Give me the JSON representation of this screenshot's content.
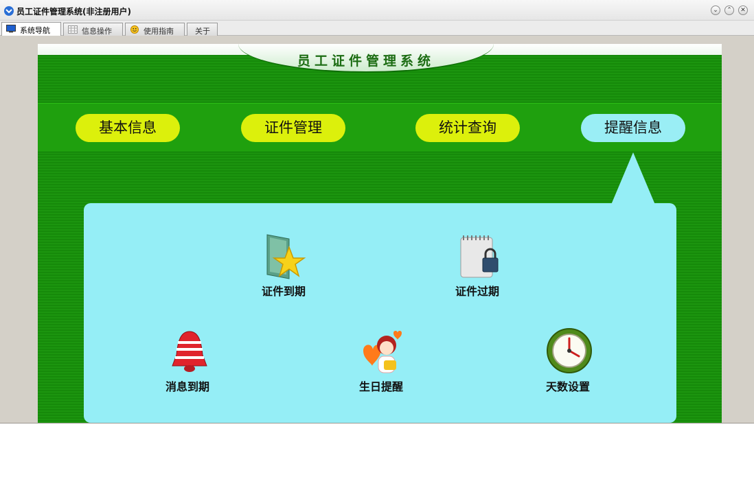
{
  "window": {
    "title": "员工证件管理系统(非注册用户)"
  },
  "tabs": [
    {
      "label": "系统导航",
      "icon": "monitor-icon",
      "active": true
    },
    {
      "label": "信息操作",
      "icon": "grid-icon",
      "active": false
    },
    {
      "label": "使用指南",
      "icon": "face-icon",
      "active": false
    },
    {
      "label": "关于",
      "icon": "",
      "active": false
    }
  ],
  "system": {
    "title": "员工证件管理系统"
  },
  "nav": [
    {
      "label": "基本信息"
    },
    {
      "label": "证件管理"
    },
    {
      "label": "统计查询"
    },
    {
      "label": "提醒信息",
      "active": true
    }
  ],
  "reminders": [
    {
      "label": "证件到期",
      "icon": "star-folder-icon"
    },
    {
      "label": "证件过期",
      "icon": "locked-notebook-icon"
    },
    {
      "label": "消息到期",
      "icon": "bell-icon"
    },
    {
      "label": "生日提醒",
      "icon": "birthday-girl-icon"
    },
    {
      "label": "天数设置",
      "icon": "clock-icon"
    }
  ],
  "colors": {
    "nav_button": "#dcf00c",
    "active_nav": "#9aeef5",
    "panel": "#95eef6",
    "background_green": "#168a0a"
  }
}
